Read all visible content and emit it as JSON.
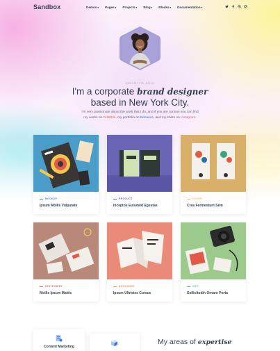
{
  "brand": {
    "logo": "Sandbox"
  },
  "nav": [
    {
      "label": "Demos",
      "caret": "▾"
    },
    {
      "label": "Pages",
      "caret": "▾"
    },
    {
      "label": "Projects",
      "caret": "▾"
    },
    {
      "label": "Blog",
      "caret": "▾"
    },
    {
      "label": "Blocks",
      "caret": "▾"
    },
    {
      "label": "Documentation",
      "caret": "▾"
    }
  ],
  "social": [
    "twitter-icon",
    "facebook-icon",
    "dribbble-icon",
    "instagram-icon"
  ],
  "hero": {
    "eyebrow": "HELLO! I'M JULIA",
    "title_prefix": "I'm a corporate ",
    "title_em": "brand designer",
    "title_line2": "based in New York City.",
    "intro_a": "I'm very passionate about the work that I do, and if you are curious you can find",
    "intro_b": "my works on ",
    "link_dribbble": "Dribbble",
    "intro_c": ", my portfolio on ",
    "link_behance": "Behance",
    "intro_d": ", and my shots on ",
    "link_instagram": "Instagram",
    "intro_e": "."
  },
  "projects": [
    {
      "category": "MOCKUP",
      "title": "Ipsum Mollis Vulputate",
      "color": "#3f78e0"
    },
    {
      "category": "PRODUCT",
      "title": "Inceptos Euismod Egestas",
      "color": "#605dba"
    },
    {
      "category": "COVER",
      "title": "Cras Fermentum Sem",
      "color": "#fab758"
    },
    {
      "category": "STATIONERY",
      "title": "Mollis Ipsum Mattis",
      "color": "#e2626b"
    },
    {
      "category": "BROCHURE",
      "title": "Ipsum Ultricies Cursus",
      "color": "#f78b77"
    },
    {
      "category": "GIFT",
      "title": "Sollicitudin Ornare Porta",
      "color": "#45c4a0"
    }
  ],
  "services": {
    "card1_label": "Content Marketing",
    "areas_prefix": "My areas of ",
    "areas_em": "expertise"
  },
  "colors": {
    "accent_red": "#e2626b",
    "accent_blue": "#3f78e0",
    "text": "#343f52"
  }
}
